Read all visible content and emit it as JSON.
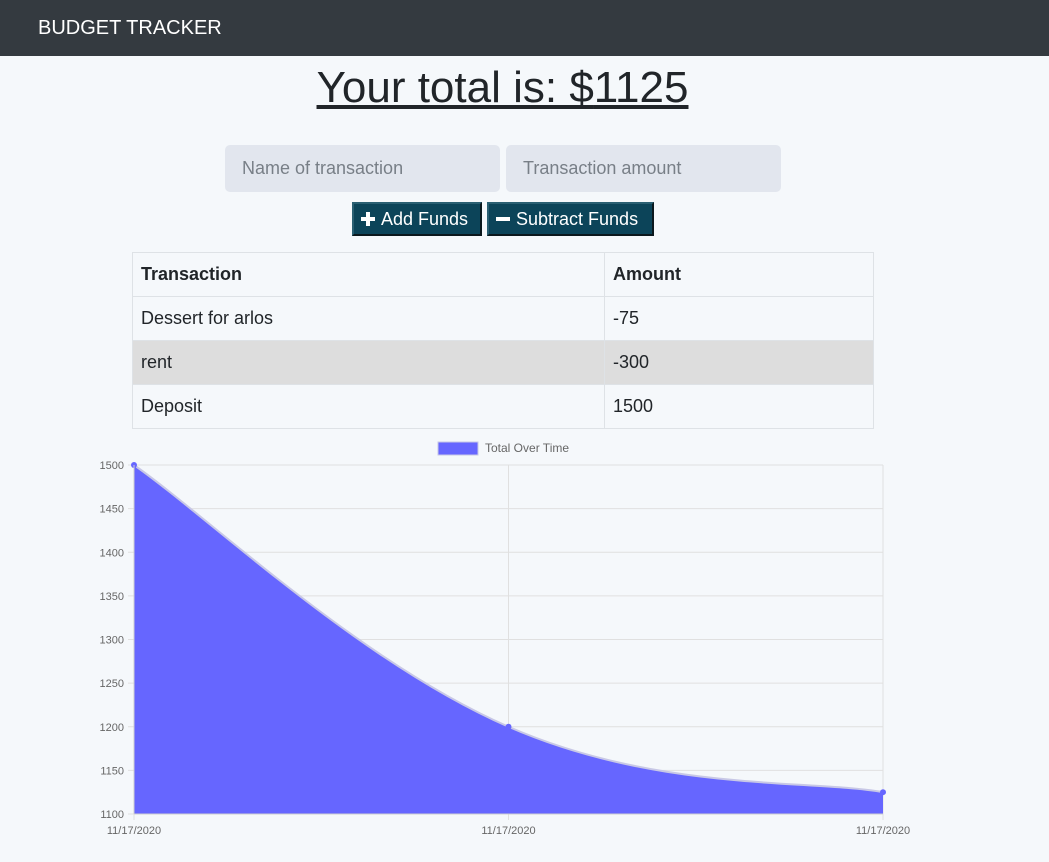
{
  "app": {
    "title": "BUDGET TRACKER"
  },
  "summary": {
    "total_label": "Your total is: $",
    "total_value": "1125"
  },
  "form": {
    "name_placeholder": "Name of transaction",
    "amount_placeholder": "Transaction amount",
    "add_label": "Add Funds",
    "subtract_label": "Subtract Funds"
  },
  "table": {
    "headers": [
      "Transaction",
      "Amount"
    ],
    "rows": [
      {
        "name": "Dessert for arlos",
        "amount": "-75"
      },
      {
        "name": "rent",
        "amount": "-300"
      },
      {
        "name": "Deposit",
        "amount": "1500"
      }
    ]
  },
  "chart_data": {
    "type": "area",
    "x": [
      "11/17/2020",
      "11/17/2020",
      "11/17/2020"
    ],
    "series": [
      {
        "name": "Total Over Time",
        "values": [
          1500,
          1200,
          1125
        ]
      }
    ],
    "ylim": [
      1100,
      1500
    ],
    "y_ticks": [
      1500,
      1450,
      1400,
      1350,
      1300,
      1250,
      1200,
      1150,
      1100
    ],
    "grid": true,
    "legend": "top-center",
    "fill_color": "#6666ff",
    "line_color": "#c8c8e6"
  }
}
